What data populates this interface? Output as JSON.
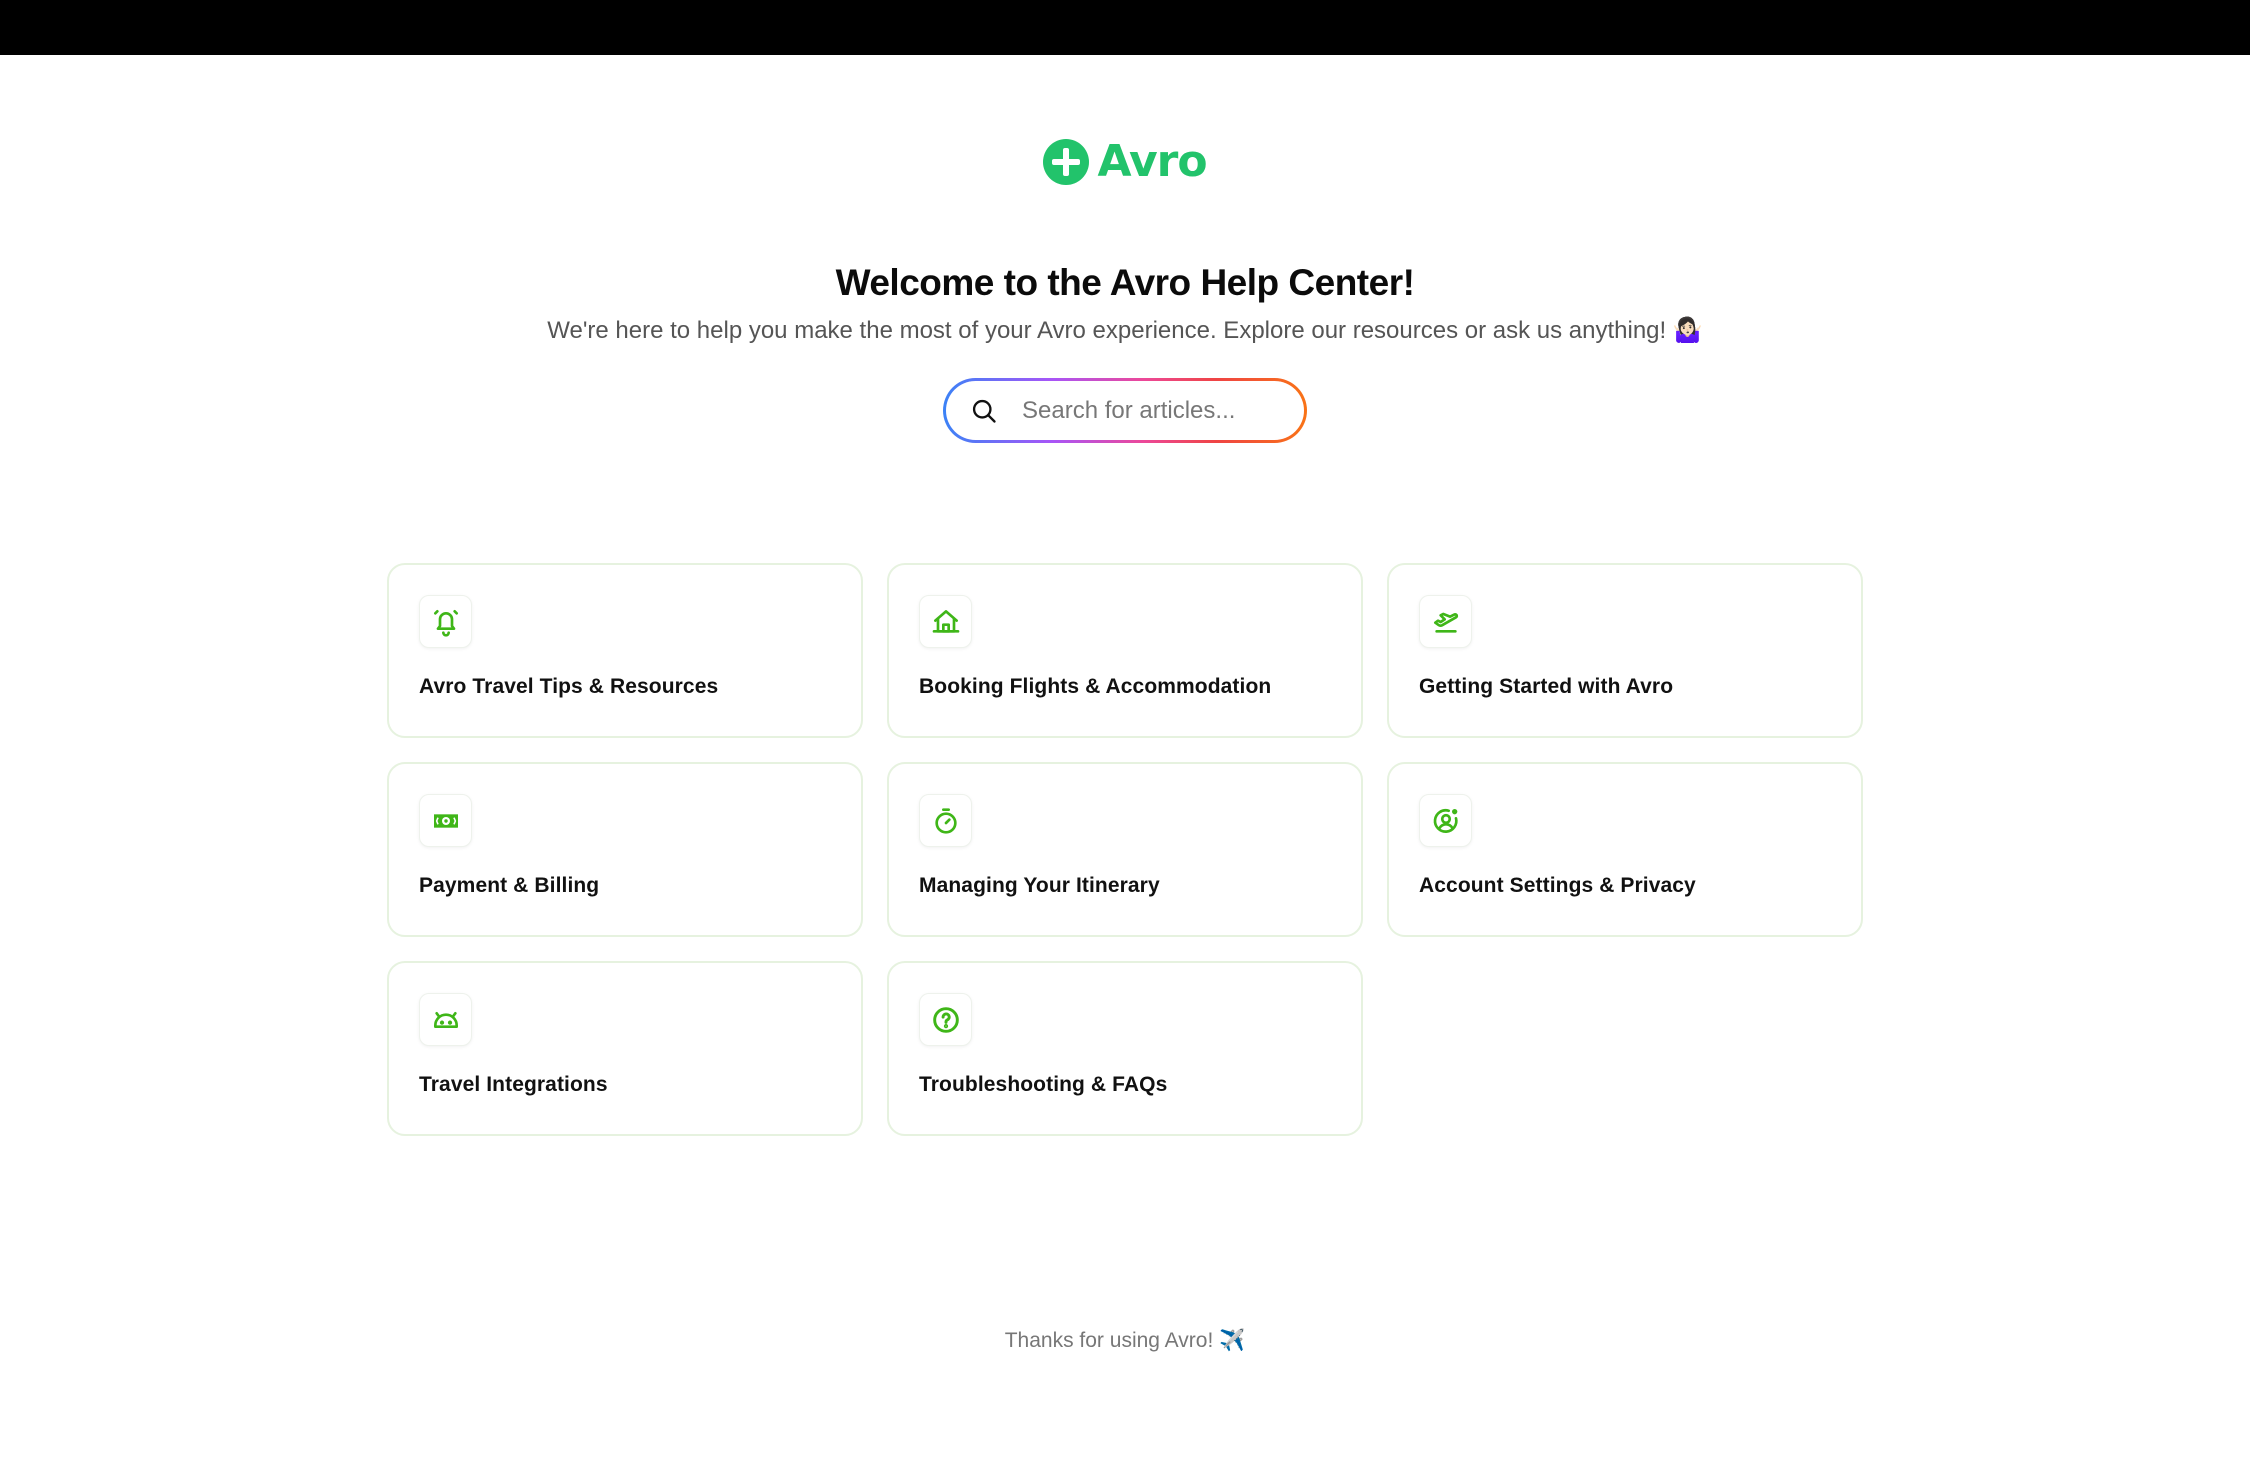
{
  "brand": {
    "name": "Avro",
    "logo_icon": "plus-circle-icon",
    "color": "#22c36b"
  },
  "hero": {
    "title": "Welcome to the Avro Help Center!",
    "subtitle": "We're here to help you make the most of your Avro experience. Explore our resources or ask us anything! 🤷🏻‍♀️"
  },
  "search": {
    "icon": "search-icon",
    "placeholder": "Search for articles...",
    "value": "",
    "border_gradient": [
      "#3b82f6",
      "#a855f7",
      "#ec4899",
      "#ef4444",
      "#f97316"
    ]
  },
  "categories": [
    {
      "label": "Avro Travel Tips & Resources",
      "icon": "alarm-bell-icon"
    },
    {
      "label": "Booking Flights & Accommodation",
      "icon": "house-icon"
    },
    {
      "label": "Getting Started with Avro",
      "icon": "plane-takeoff-icon"
    },
    {
      "label": "Payment & Billing",
      "icon": "banknote-icon"
    },
    {
      "label": "Managing Your Itinerary",
      "icon": "stopwatch-icon"
    },
    {
      "label": "Account Settings & Privacy",
      "icon": "user-circle-settings-icon"
    },
    {
      "label": "Travel Integrations",
      "icon": "android-icon"
    },
    {
      "label": "Troubleshooting & FAQs",
      "icon": "question-circle-icon"
    }
  ],
  "icon_color": "#3fb618",
  "footer": {
    "text": "Thanks for using Avro! ✈️"
  }
}
